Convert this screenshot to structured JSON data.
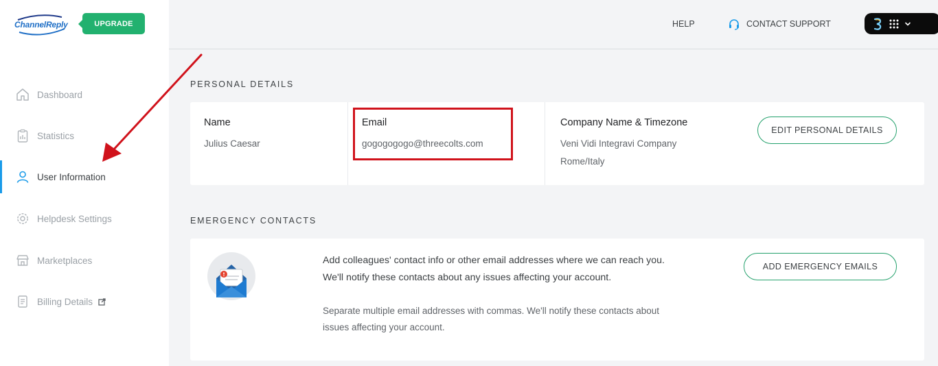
{
  "brand": {
    "logo_text": "ChannelReply",
    "upgrade_label": "UPGRADE"
  },
  "sidebar": {
    "items": [
      {
        "label": "Dashboard",
        "icon": "home-icon"
      },
      {
        "label": "Statistics",
        "icon": "clipboard-chart-icon"
      },
      {
        "label": "User Information",
        "icon": "user-icon",
        "active": true
      },
      {
        "label": "Helpdesk Settings",
        "icon": "gear-icon"
      },
      {
        "label": "Marketplaces",
        "icon": "store-icon"
      },
      {
        "label": "Billing Details",
        "icon": "receipt-icon",
        "external": true
      }
    ]
  },
  "header": {
    "help_label": "HELP",
    "support_label": "CONTACT SUPPORT"
  },
  "personal": {
    "section_title": "PERSONAL DETAILS",
    "name_label": "Name",
    "name_value": "Julius Caesar",
    "email_label": "Email",
    "email_value": "gogogogogo@threecolts.com",
    "company_label": "Company Name & Timezone",
    "company_value": "Veni Vidi Integravi Company",
    "timezone_value": "Rome/Italy",
    "edit_button": "EDIT PERSONAL DETAILS"
  },
  "emergency": {
    "section_title": "EMERGENCY CONTACTS",
    "description": "Add colleagues' contact info or other email addresses where we can reach you. We'll notify these contacts about any issues affecting your account.",
    "note": "Separate multiple email addresses with commas. We'll notify these contacts about issues affecting your account.",
    "add_button": "ADD EMERGENCY EMAILS"
  },
  "colors": {
    "accent_green": "#22b16f",
    "active_blue": "#1a9be9",
    "highlight_red": "#d0121b"
  }
}
